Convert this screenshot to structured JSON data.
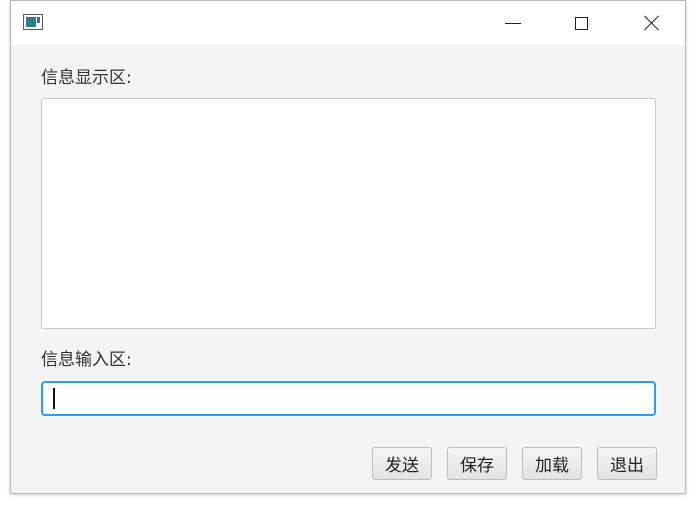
{
  "window": {
    "title": ""
  },
  "labels": {
    "display_area": "信息显示区:",
    "input_area": "信息输入区:"
  },
  "display_area": {
    "content": ""
  },
  "input_field": {
    "value": ""
  },
  "buttons": {
    "send": "发送",
    "save": "保存",
    "load": "加载",
    "exit": "退出"
  },
  "colors": {
    "focus_accent": "#2f9cf0",
    "window_background": "#f4f4f4"
  }
}
